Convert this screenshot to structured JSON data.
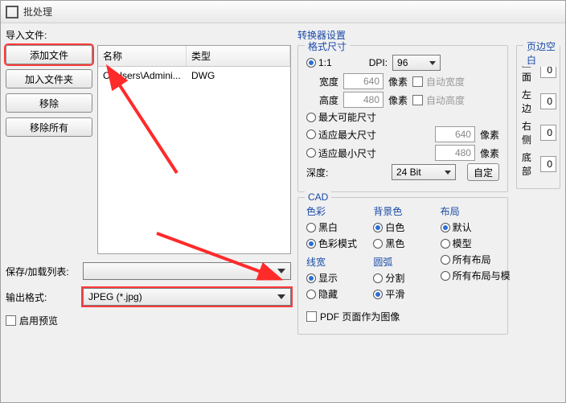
{
  "window": {
    "title": "批处理"
  },
  "left": {
    "import_label": "导入文件:",
    "btn_add_file": "添加文件",
    "btn_add_folder": "加入文件夹",
    "btn_remove": "移除",
    "btn_remove_all": "移除所有",
    "table": {
      "col_name": "名称",
      "col_type": "类型",
      "rows": [
        {
          "name": "C:\\Users\\Admini...",
          "type": "DWG"
        }
      ]
    },
    "save_list_label": "保存/加载列表:",
    "save_list_value": "",
    "output_format_label": "输出格式:",
    "output_format_value": "JPEG (*.jpg)",
    "enable_preview": "启用预览"
  },
  "converter": {
    "title": "转换器设置",
    "size": {
      "title": "格式尺寸",
      "one_to_one": "1:1",
      "dpi_label": "DPI:",
      "dpi_value": "96",
      "width_label": "宽度",
      "width_value": "640",
      "pixel": "像素",
      "auto_width": "自动宽度",
      "height_label": "高度",
      "height_value": "480",
      "auto_height": "自动高度",
      "max_possible": "最大可能尺寸",
      "fit_max": "适应最大尺寸",
      "fit_max_v": "640",
      "fit_min": "适应最小尺寸",
      "fit_min_v": "480",
      "depth_label": "深度:",
      "depth_value": "24 Bit",
      "custom_btn": "自定"
    },
    "cad": {
      "title": "CAD",
      "color_title": "色彩",
      "color_bw": "黑白",
      "color_mode": "色彩模式",
      "bg_title": "背景色",
      "bg_white": "白色",
      "bg_black": "黑色",
      "lw_title": "线宽",
      "lw_show": "显示",
      "lw_hide": "隐藏",
      "arc_title": "圆弧",
      "arc_split": "分割",
      "arc_smooth": "平滑",
      "layout_title": "布局",
      "layout_default": "默认",
      "layout_model": "模型",
      "layout_all": "所有布局",
      "layout_all_model": "所有布局与模",
      "pdf_page_image": "PDF 页面作为图像"
    },
    "margin": {
      "title": "页边空白",
      "top": "上面",
      "left": "左边",
      "right": "右侧",
      "bottom": "底部",
      "val": "0"
    }
  }
}
